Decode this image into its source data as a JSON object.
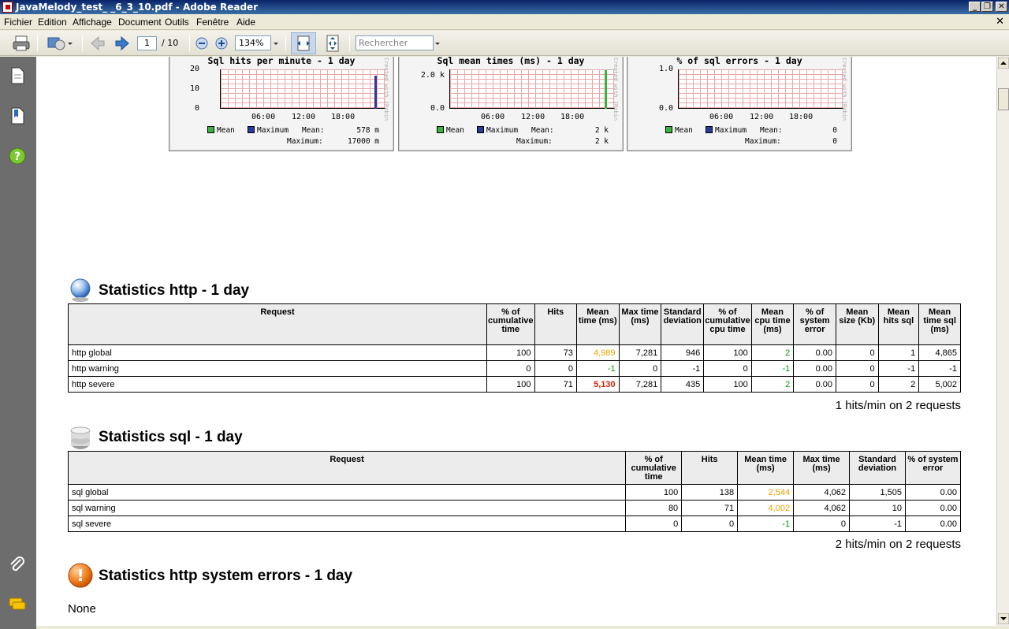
{
  "window": {
    "title": "JavaMelody_test_          _6_3_10.pdf - Adobe Reader",
    "minimize": "_",
    "restore": "❐",
    "close": "✕"
  },
  "menu": {
    "items": [
      "Fichier",
      "Edition",
      "Affichage",
      "Document",
      "Outils",
      "Fenêtre",
      "Aide"
    ],
    "close": "✕"
  },
  "toolbar": {
    "page_current": "1",
    "page_total": "/ 10",
    "zoom": "134%",
    "search_placeholder": "Rechercher"
  },
  "graphs": [
    {
      "title": "Sql hits per minute - 1 day",
      "y_ticks": [
        "20",
        "10",
        "0"
      ],
      "x_ticks": [
        "06:00",
        "12:00",
        "18:00"
      ],
      "legend": {
        "mean": "Mean",
        "max": "Maximum",
        "mean_label": "Mean:",
        "mean_value": "578 m",
        "max_label": "Maximum:",
        "max_value": "17000 m"
      },
      "side": "Created with JRobin",
      "series_color": "#2a3a9a"
    },
    {
      "title": "Sql mean times (ms) - 1 day",
      "y_ticks": [
        "2.0 k",
        "0.0"
      ],
      "x_ticks": [
        "06:00",
        "12:00",
        "18:00"
      ],
      "legend": {
        "mean": "Mean",
        "max": "Maximum",
        "mean_label": "Mean:",
        "mean_value": "2 k",
        "max_label": "Maximum:",
        "max_value": "2 k"
      },
      "side": "Created with JRobin",
      "series_color": "#3cb043"
    },
    {
      "title": "% of sql errors - 1 day",
      "y_ticks": [
        "1.0",
        "0.0"
      ],
      "x_ticks": [
        "06:00",
        "12:00",
        "18:00"
      ],
      "legend": {
        "mean": "Mean",
        "max": "Maximum",
        "mean_label": "Mean:",
        "mean_value": "0",
        "max_label": "Maximum:",
        "max_value": "0"
      },
      "side": "Created with JRobin",
      "series_color": "#3cb043"
    }
  ],
  "legend_colors": {
    "mean": "#3cb043",
    "max": "#2a3a9a"
  },
  "http": {
    "title": "Statistics http - 1 day",
    "headers": [
      "Request",
      "% of cumulative time",
      "Hits",
      "Mean time (ms)",
      "Max time (ms)",
      "Standard deviation",
      "% of cumulative cpu time",
      "Mean cpu time (ms)",
      "% of system error",
      "Mean size (Kb)",
      "Mean hits sql",
      "Mean time sql (ms)"
    ],
    "rows": [
      [
        "http global",
        "100",
        "73",
        "4,989",
        "7,281",
        "946",
        "100",
        "2",
        "0.00",
        "0",
        "1",
        "4,865"
      ],
      [
        "http warning",
        "0",
        "0",
        "-1",
        "0",
        "-1",
        "0",
        "-1",
        "0.00",
        "0",
        "-1",
        "-1"
      ],
      [
        "http severe",
        "100",
        "71",
        "5,130",
        "7,281",
        "435",
        "100",
        "2",
        "0.00",
        "0",
        "2",
        "5,002"
      ]
    ],
    "summary": "1 hits/min on 2 requests"
  },
  "sql": {
    "title": "Statistics sql - 1 day",
    "headers": [
      "Request",
      "% of cumulative time",
      "Hits",
      "Mean time (ms)",
      "Max time (ms)",
      "Standard deviation",
      "% of system error"
    ],
    "rows": [
      [
        "sql global",
        "100",
        "138",
        "2,544",
        "4,062",
        "1,505",
        "0.00"
      ],
      [
        "sql warning",
        "80",
        "71",
        "4,002",
        "4,062",
        "10",
        "0.00"
      ],
      [
        "sql severe",
        "0",
        "0",
        "-1",
        "0",
        "-1",
        "0.00"
      ]
    ],
    "summary": "2 hits/min on 2 requests"
  },
  "errors": {
    "title": "Statistics http system errors - 1 day",
    "icon_text": "!",
    "body": "None"
  },
  "colors": {
    "warn": "#f0a000",
    "severe": "#e02000",
    "good": "#00a000"
  }
}
